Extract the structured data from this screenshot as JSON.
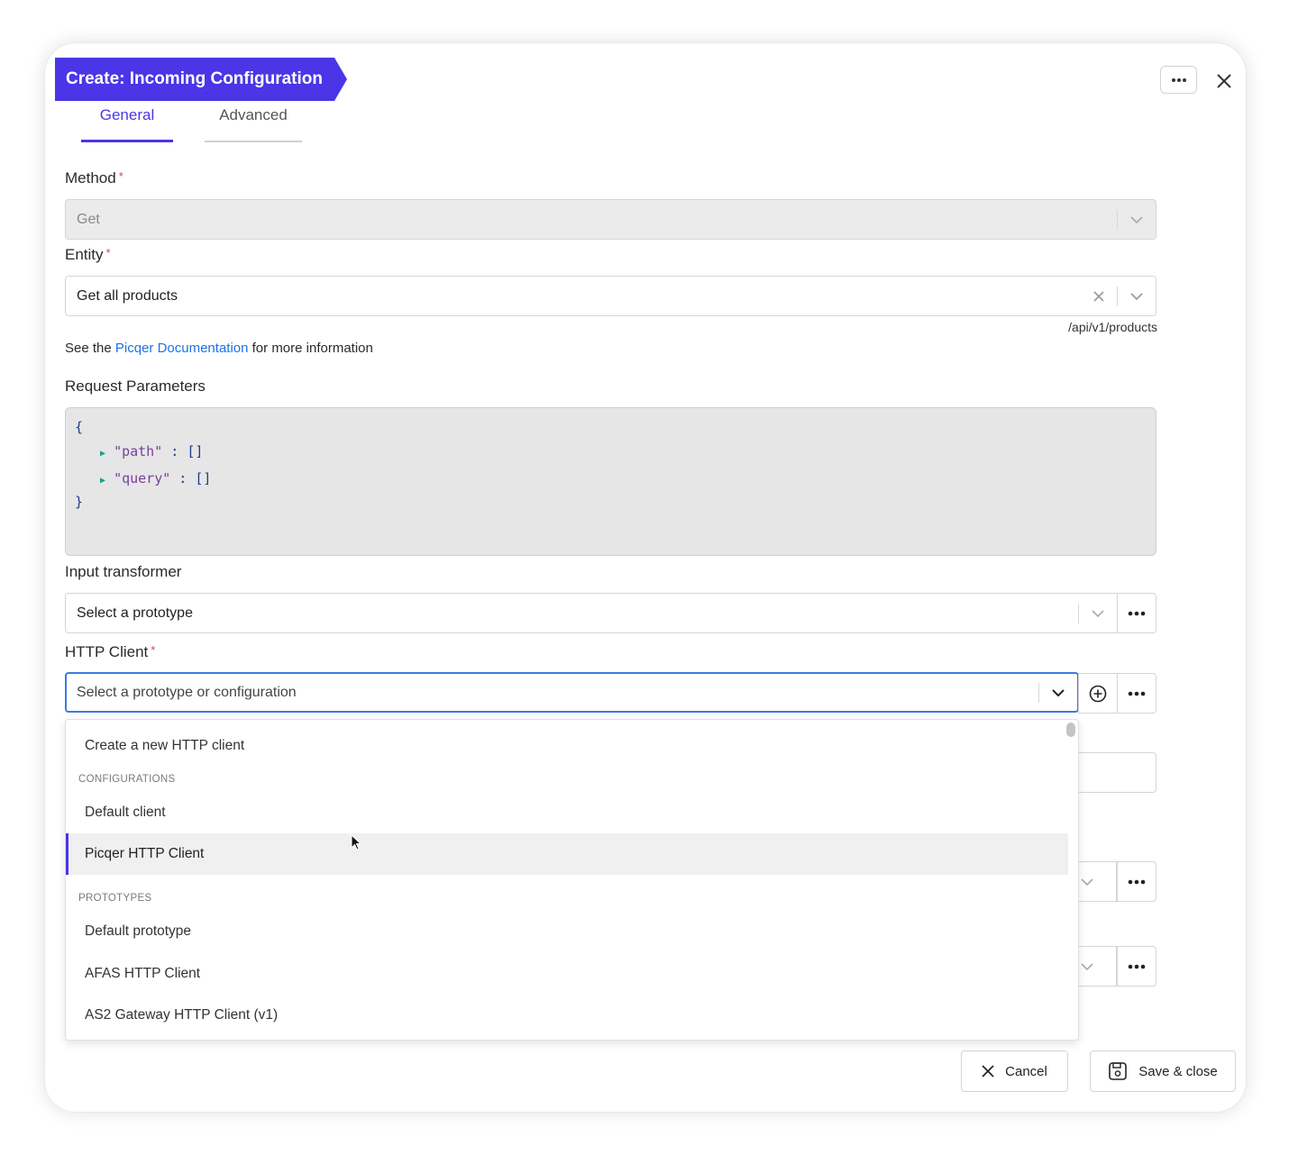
{
  "header": {
    "title": "Create: Incoming Configuration"
  },
  "tabs": [
    {
      "label": "General",
      "active": true
    },
    {
      "label": "Advanced",
      "active": false
    }
  ],
  "method": {
    "label": "Method",
    "required": "*",
    "value": "Get"
  },
  "entity": {
    "label": "Entity",
    "required": "*",
    "value": "Get all products",
    "endpoint": "/api/v1/products"
  },
  "info": {
    "prefix": "See the",
    "link": "Picqer Documentation",
    "suffix": "for more information"
  },
  "request_parameters": {
    "label": "Request Parameters",
    "open_brace": "{",
    "close_brace": "}",
    "lines": [
      {
        "key": "\"path\"",
        "rest": " : []"
      },
      {
        "key": "\"query\"",
        "rest": " : []"
      }
    ]
  },
  "input_transformer": {
    "label": "Input transformer",
    "placeholder": "Select a prototype"
  },
  "http_client": {
    "label": "HTTP Client",
    "required": "*",
    "placeholder": "Select a prototype or configuration"
  },
  "dropdown": {
    "create_item": "Create a new HTTP client",
    "configurations_header": "CONFIGURATIONS",
    "configurations": [
      "Default client",
      "Picqer HTTP Client"
    ],
    "highlighted": "Picqer HTTP Client",
    "prototypes_header": "PROTOTYPES",
    "prototypes": [
      "Default prototype",
      "AFAS HTTP Client",
      "AS2 Gateway HTTP Client (v1)"
    ]
  },
  "footer": {
    "cancel_label": "Cancel",
    "save_label": "Save & close"
  },
  "colors": {
    "accent": "#4a36e6",
    "link": "#1a73e8",
    "required": "#e04545"
  },
  "icons": [
    "ellipsis-icon",
    "close-icon",
    "chevron-down-icon",
    "clear-icon",
    "plus-circle-icon",
    "save-icon",
    "mouse-cursor-icon"
  ]
}
